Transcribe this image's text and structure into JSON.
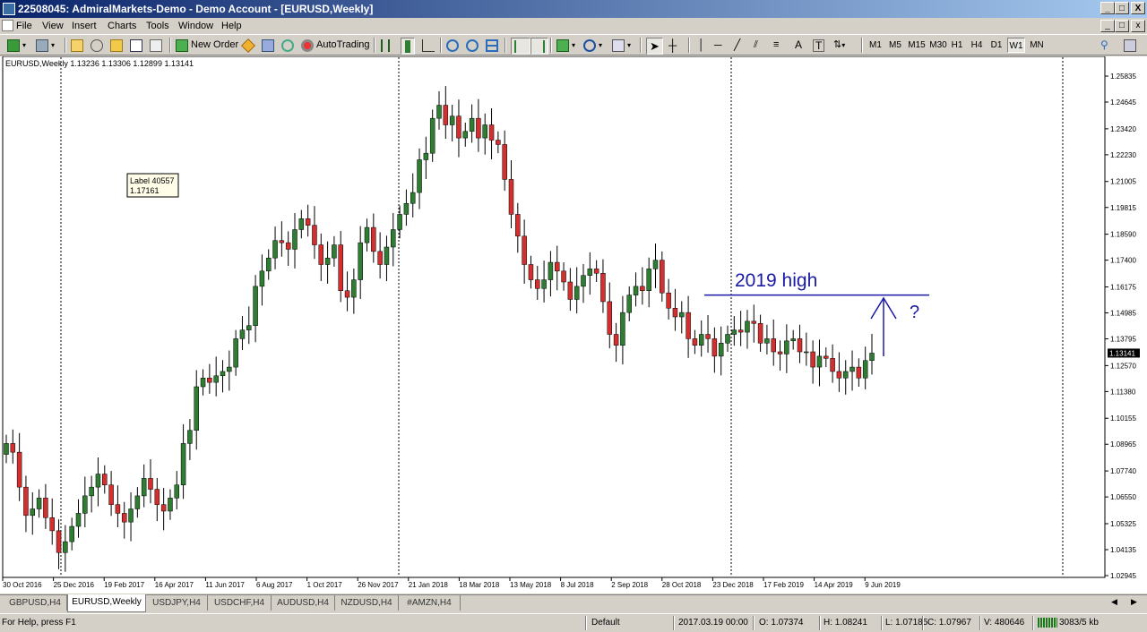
{
  "window": {
    "title": "22508045: AdmiralMarkets-Demo - Demo Account - [EURUSD,Weekly]",
    "minimize": "_",
    "restore": "□",
    "close": "X"
  },
  "menu": {
    "items": [
      "File",
      "View",
      "Insert",
      "Charts",
      "Tools",
      "Window",
      "Help"
    ]
  },
  "toolbar": {
    "new_order": "New Order",
    "autotrading": "AutoTrading",
    "timeframes": [
      "M1",
      "M5",
      "M15",
      "M30",
      "H1",
      "H4",
      "D1",
      "W1",
      "MN"
    ],
    "active_timeframe": "W1",
    "icons": [
      "new-chart-icon",
      "profiles-icon",
      "market-watch-icon",
      "navigator-icon",
      "data-window-icon",
      "terminal-icon",
      "strategy-tester-icon",
      "new-order-icon",
      "metaeditor-icon",
      "signals-icon",
      "autotrading-icon",
      "bar-chart-icon",
      "candlestick-icon",
      "line-chart-icon",
      "zoom-in-icon",
      "zoom-out-icon",
      "tile-windows-icon",
      "autoscroll-icon",
      "chart-shift-icon",
      "indicators-icon",
      "periods-icon",
      "templates-icon",
      "cursor-icon",
      "crosshair-icon",
      "vertical-line-icon",
      "horizontal-line-icon",
      "trendline-icon",
      "equidistant-channel-icon",
      "fibonacci-icon",
      "text-icon",
      "text-label-icon",
      "arrows-icon",
      "search-icon",
      "community-icon"
    ]
  },
  "chart": {
    "symbol_info": "EURUSD,Weekly  1.13236 1.13306 1.12899 1.13141",
    "current_price": "1.13141",
    "label_object": {
      "line1": "Label 40557",
      "line2": "1.17161"
    },
    "annotation_text": "2019 high",
    "annotation_question": "?",
    "annotation_level": 1.158,
    "price_ticks": [
      "1.25835",
      "1.24645",
      "1.23420",
      "1.22230",
      "1.21005",
      "1.19815",
      "1.18590",
      "1.17400",
      "1.16175",
      "1.14985",
      "1.13795",
      "1.12570",
      "1.11380",
      "1.10155",
      "1.08965",
      "1.07740",
      "1.06550",
      "1.05325",
      "1.04135",
      "1.02945"
    ],
    "date_ticks": [
      "30 Oct 2016",
      "25 Dec 2016",
      "19 Feb 2017",
      "16 Apr 2017",
      "11 Jun 2017",
      "6 Aug 2017",
      "1 Oct 2017",
      "26 Nov 2017",
      "21 Jan 2018",
      "18 Mar 2018",
      "13 May 2018",
      "8 Jul 2018",
      "2 Sep 2018",
      "28 Oct 2018",
      "23 Dec 2018",
      "17 Feb 2019",
      "14 Apr 2019",
      "9 Jun 2019"
    ],
    "colors": {
      "bull": "#2e7d32",
      "bear": "#d32f2f",
      "annotation": "#1a1aa6"
    }
  },
  "chart_data": {
    "type": "candlestick",
    "symbol": "EURUSD",
    "timeframe": "Weekly",
    "x": "weekly bars from 30 Oct 2016 to 9 Jun 2019",
    "close": [
      1.09,
      1.086,
      1.07,
      1.057,
      1.06,
      1.065,
      1.056,
      1.05,
      1.04,
      1.045,
      1.052,
      1.058,
      1.066,
      1.07,
      1.076,
      1.071,
      1.062,
      1.058,
      1.054,
      1.06,
      1.066,
      1.074,
      1.069,
      1.062,
      1.059,
      1.065,
      1.071,
      1.09,
      1.096,
      1.116,
      1.12,
      1.118,
      1.121,
      1.123,
      1.125,
      1.138,
      1.142,
      1.144,
      1.162,
      1.169,
      1.175,
      1.183,
      1.182,
      1.179,
      1.188,
      1.193,
      1.19,
      1.181,
      1.172,
      1.175,
      1.181,
      1.16,
      1.157,
      1.165,
      1.182,
      1.189,
      1.178,
      1.172,
      1.18,
      1.188,
      1.195,
      1.2,
      1.205,
      1.22,
      1.223,
      1.239,
      1.245,
      1.236,
      1.24,
      1.23,
      1.233,
      1.239,
      1.23,
      1.236,
      1.229,
      1.227,
      1.211,
      1.195,
      1.185,
      1.172,
      1.165,
      1.161,
      1.165,
      1.173,
      1.169,
      1.164,
      1.156,
      1.162,
      1.167,
      1.17,
      1.168,
      1.155,
      1.14,
      1.135,
      1.15,
      1.158,
      1.162,
      1.16,
      1.17,
      1.174,
      1.159,
      1.152,
      1.148,
      1.15,
      1.138,
      1.135,
      1.14,
      1.138,
      1.13,
      1.136,
      1.14,
      1.142,
      1.141,
      1.146,
      1.145,
      1.136,
      1.138,
      1.132,
      1.131,
      1.137,
      1.138,
      1.132,
      1.132,
      1.125,
      1.13,
      1.129,
      1.123,
      1.12,
      1.123,
      1.125,
      1.12,
      1.128,
      1.1314
    ]
  },
  "tabs": [
    "GBPUSD,H4",
    "EURUSD,Weekly",
    "USDJPY,H4",
    "USDCHF,H4",
    "AUDUSD,H4",
    "NZDUSD,H4",
    "#AMZN,H4"
  ],
  "active_tab": "EURUSD,Weekly",
  "status": {
    "help": "For Help, press F1",
    "profile": "Default",
    "datetime": "2017.03.19 00:00",
    "open": "O: 1.07374",
    "high": "H: 1.08241",
    "low": "L: 1.07185",
    "close": "C: 1.07967",
    "volume": "V: 480646",
    "traffic": "3083/5 kb"
  }
}
